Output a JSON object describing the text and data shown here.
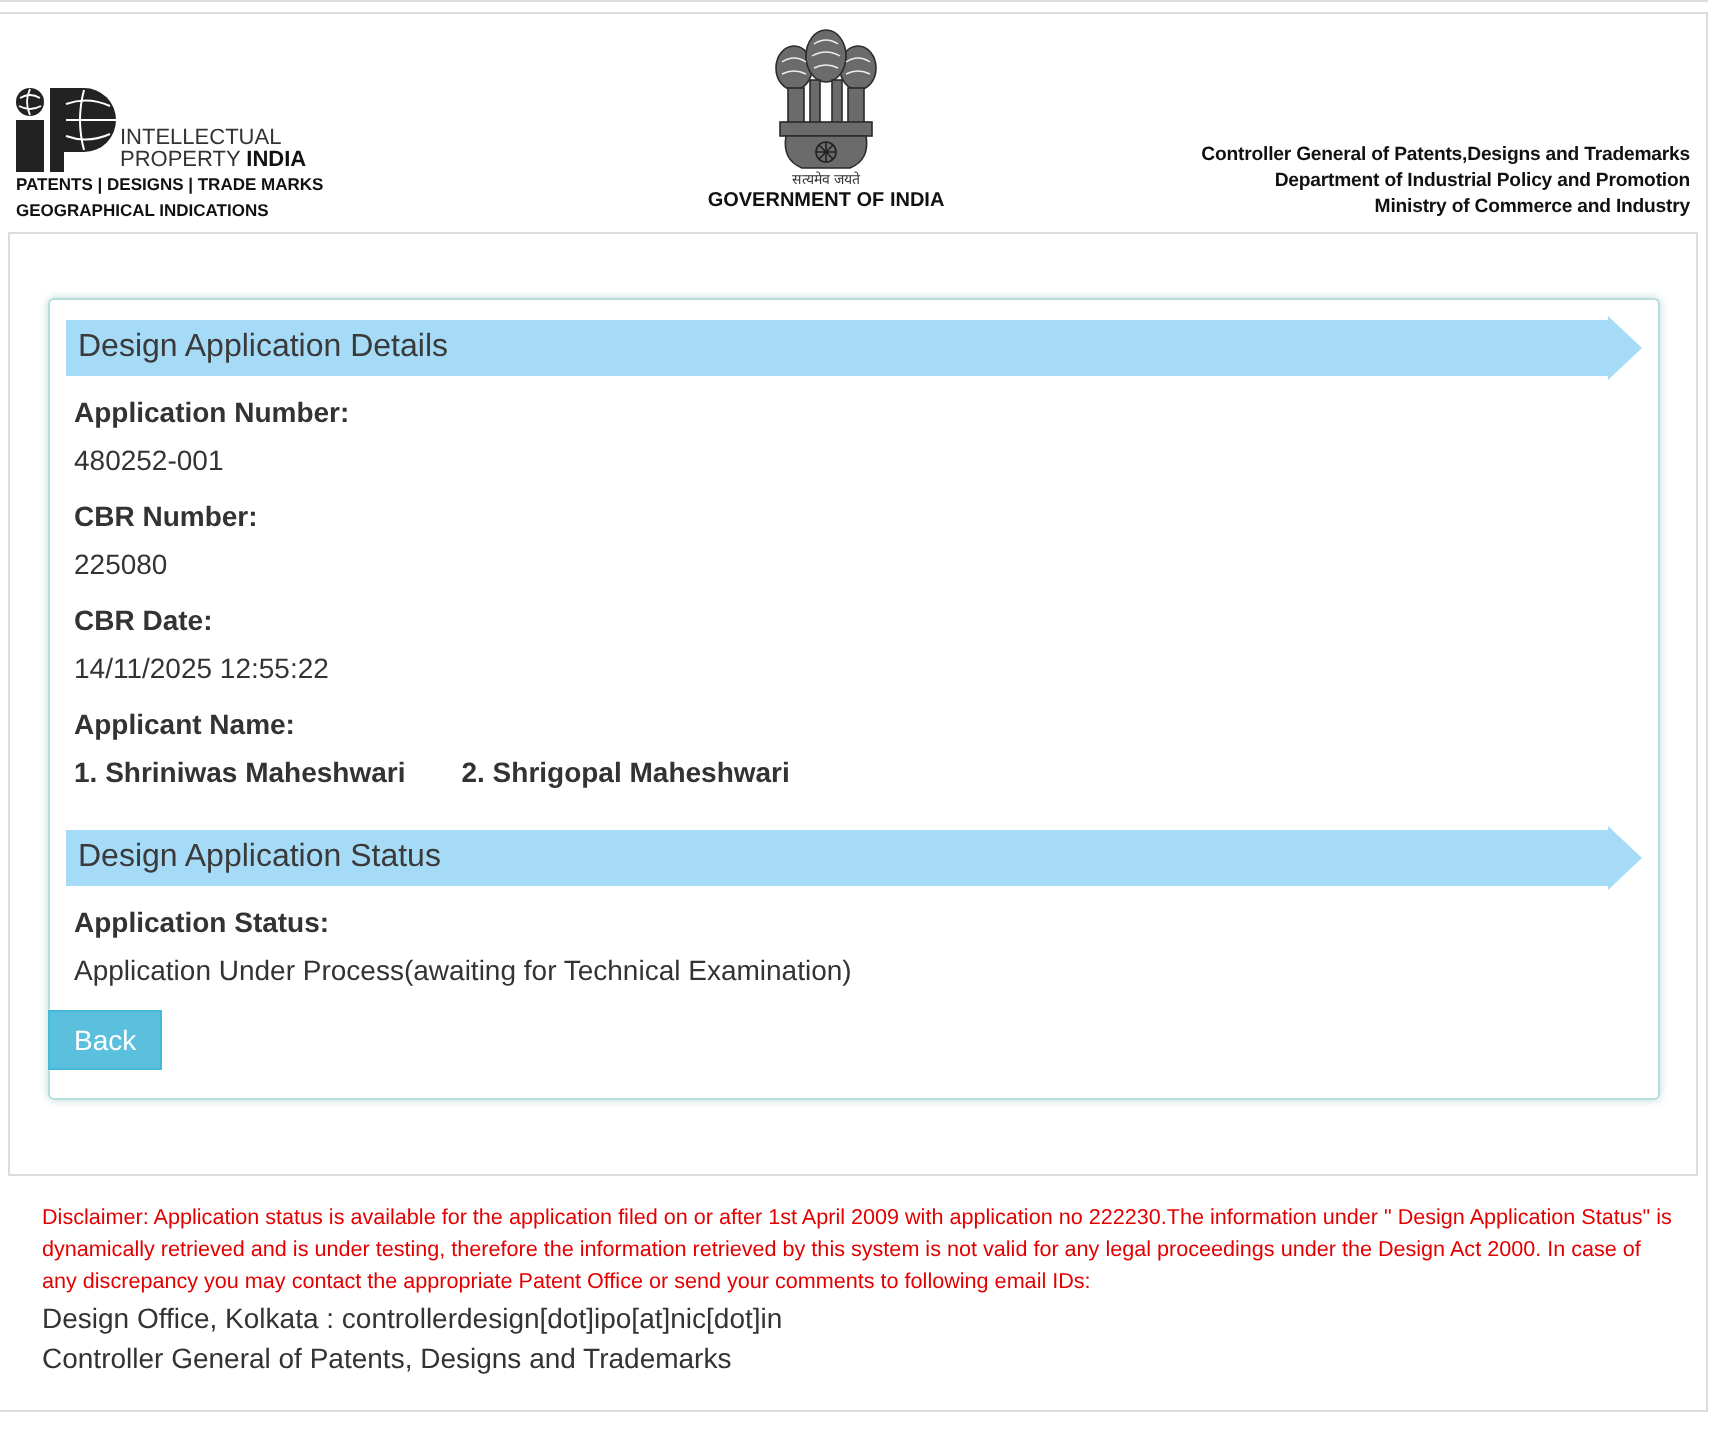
{
  "header": {
    "logo": {
      "line_1": "INTELLECTUAL",
      "line_2": "PROPERTY **INDIA**",
      "tagline_1": "PATENTS | DESIGNS | TRADE MARKS",
      "tagline_2": "GEOGRAPHICAL INDICATIONS"
    },
    "emblem": {
      "motto": "सत्यमेव जयते",
      "caption": "GOVERNMENT OF INDIA"
    },
    "authority": [
      "Controller General of Patents,Designs and Trademarks",
      "Department of Industrial Policy and Promotion",
      "Ministry of Commerce and Industry"
    ]
  },
  "sections": [
    {
      "title": "Design Application Details",
      "fields": [
        {
          "kind": "value",
          "label": "Application Number:",
          "value": "480252-001"
        },
        {
          "kind": "value",
          "label": "CBR Number:",
          "value": "225080"
        },
        {
          "kind": "value",
          "label": "CBR Date:",
          "value": "14/11/2025 12:55:22"
        },
        {
          "kind": "names",
          "label": "Applicant Name:",
          "names": [
            "1. Shriniwas Maheshwari",
            "2. Shrigopal Maheshwari"
          ]
        }
      ]
    },
    {
      "title": "Design Application Status",
      "fields": [
        {
          "kind": "value",
          "label": "Application Status:",
          "value": "Application Under Process(awaiting for Technical Examination)"
        }
      ]
    }
  ],
  "back_button": "Back",
  "disclaimer": "Disclaimer: Application status is available for the application filed on or after 1st April 2009 with application no 222230.The information under \" Design Application Status\" is dynamically retrieved and is under testing, therefore the information retrieved by this system is not valid for any legal proceedings under the Design Act 2000. In case of any discrepancy you may contact the appropriate Patent Office or send your comments to following email IDs:",
  "contacts": [
    "Design Office, Kolkata : controllerdesign[dot]ipo[at]nic[dot]in",
    "Controller General of Patents, Designs and Trademarks"
  ]
}
